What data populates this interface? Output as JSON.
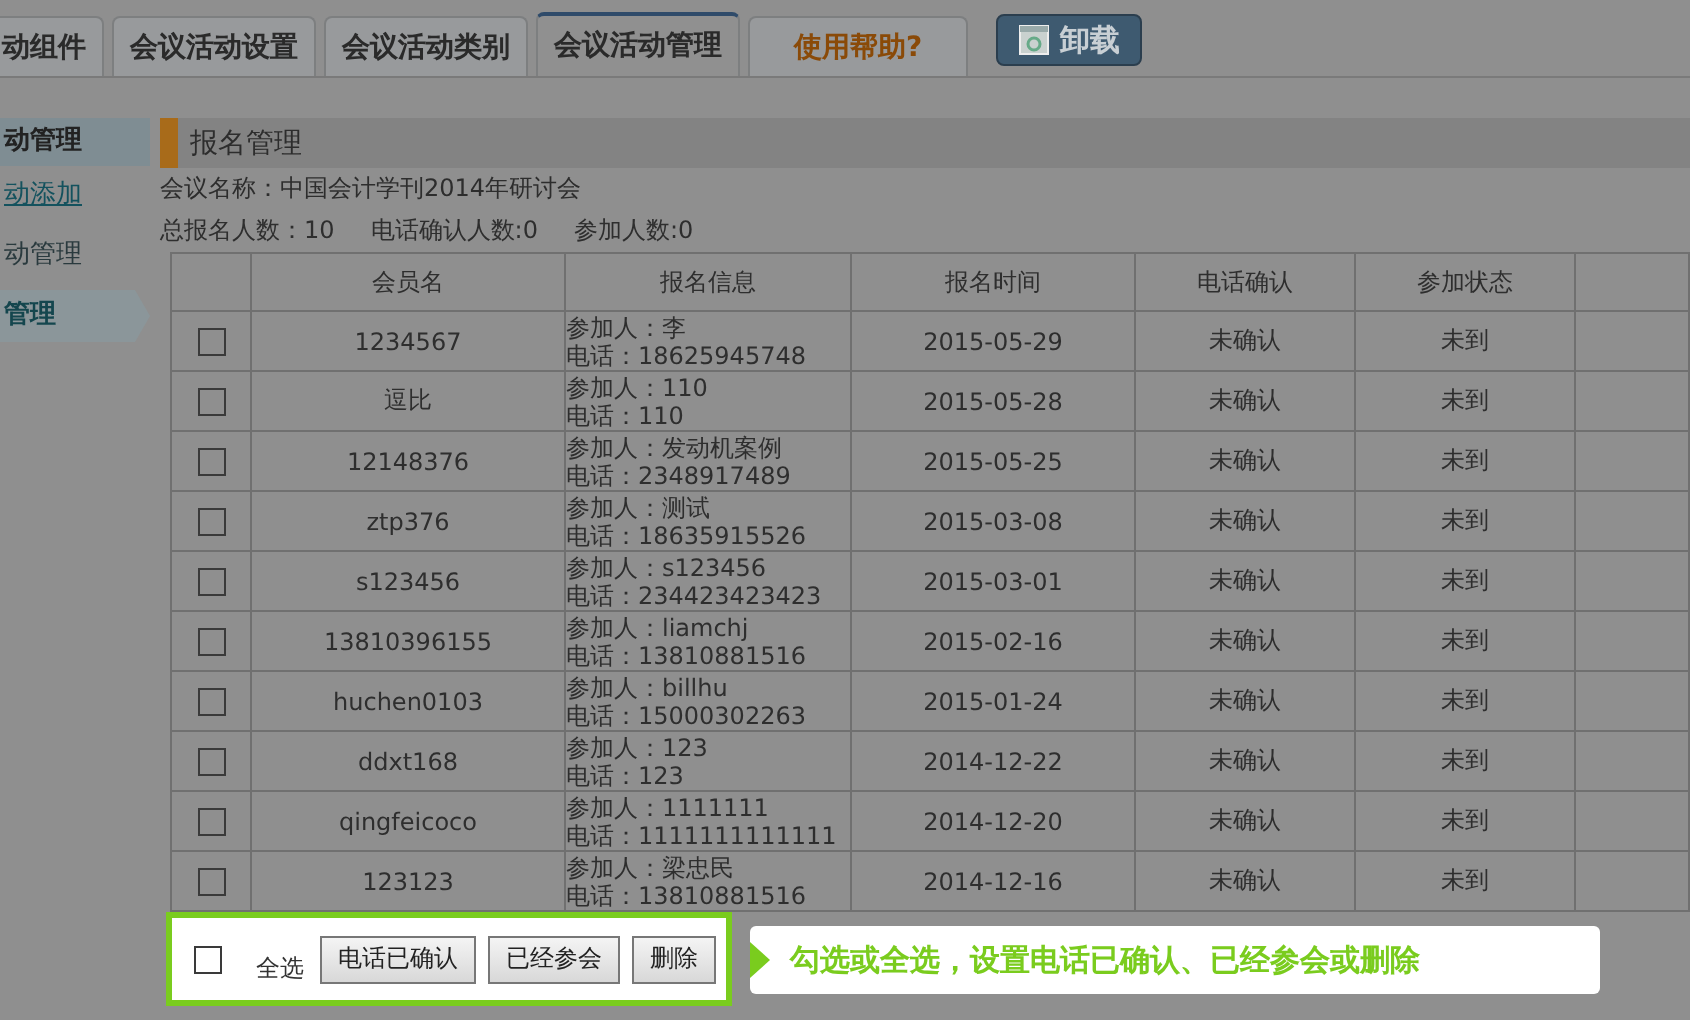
{
  "tabs": [
    {
      "label": "动组件",
      "kind": "tab",
      "selected": false
    },
    {
      "label": "会议活动设置",
      "kind": "tab",
      "selected": false
    },
    {
      "label": "会议活动类别",
      "kind": "tab",
      "selected": false
    },
    {
      "label": "会议活动管理",
      "kind": "tab",
      "selected": true
    },
    {
      "label": "使用帮助?",
      "kind": "help",
      "selected": false
    },
    {
      "label": "卸载",
      "kind": "uninstall"
    }
  ],
  "sidebar": {
    "title": "动管理",
    "items": [
      {
        "label": "动添加",
        "kind": "link",
        "selected": false
      },
      {
        "label": "动管理",
        "kind": "plain",
        "selected": false
      },
      {
        "label": "管理",
        "kind": "plain",
        "selected": true
      }
    ]
  },
  "section_title": "报名管理",
  "meeting_name": "会议名称：中国会计学刊2014年研讨会",
  "stats": [
    "总报名人数：10",
    "电话确认人数:0",
    "参加人数:0"
  ],
  "table": {
    "columns": [
      "会员名",
      "报名信息",
      "报名时间",
      "电话确认",
      "参加状态"
    ],
    "rows": [
      {
        "checked": false,
        "member": "1234567",
        "info": [
          "参加人：李",
          "电话：18625945748"
        ],
        "time": "2015-05-29",
        "phone": "未确认",
        "status": "未到"
      },
      {
        "checked": false,
        "member": "逗比",
        "info": [
          "参加人：110",
          "电话：110"
        ],
        "time": "2015-05-28",
        "phone": "未确认",
        "status": "未到"
      },
      {
        "checked": false,
        "member": "12148376",
        "info": [
          "参加人：发动机案例",
          "电话：2348917489"
        ],
        "time": "2015-05-25",
        "phone": "未确认",
        "status": "未到"
      },
      {
        "checked": false,
        "member": "ztp376",
        "info": [
          "参加人：测试",
          "电话：18635915526"
        ],
        "time": "2015-03-08",
        "phone": "未确认",
        "status": "未到"
      },
      {
        "checked": false,
        "member": "s123456",
        "info": [
          "参加人：s123456",
          "电话：234423423423"
        ],
        "time": "2015-03-01",
        "phone": "未确认",
        "status": "未到"
      },
      {
        "checked": false,
        "member": "13810396155",
        "info": [
          "参加人：liamchj",
          "电话：13810881516"
        ],
        "time": "2015-02-16",
        "phone": "未确认",
        "status": "未到"
      },
      {
        "checked": false,
        "member": "huchen0103",
        "info": [
          "参加人：billhu",
          "电话：15000302263"
        ],
        "time": "2015-01-24",
        "phone": "未确认",
        "status": "未到"
      },
      {
        "checked": false,
        "member": "ddxt168",
        "info": [
          "参加人：123",
          "电话：123"
        ],
        "time": "2014-12-22",
        "phone": "未确认",
        "status": "未到"
      },
      {
        "checked": false,
        "member": "qingfeicoco",
        "info": [
          "参加人：1111111",
          "电话：1111111111111"
        ],
        "time": "2014-12-20",
        "phone": "未确认",
        "status": "未到"
      },
      {
        "checked": false,
        "member": "123123",
        "info": [
          "参加人：梁忠民",
          "电话：13810881516"
        ],
        "time": "2014-12-16",
        "phone": "未确认",
        "status": "未到"
      }
    ]
  },
  "bulk": {
    "checked": false,
    "select_all": "全选",
    "buttons": [
      "电话已确认",
      "已经参会",
      "删除"
    ]
  },
  "tooltip": "勾选或全选，设置电话已确认、已经参会或删除"
}
